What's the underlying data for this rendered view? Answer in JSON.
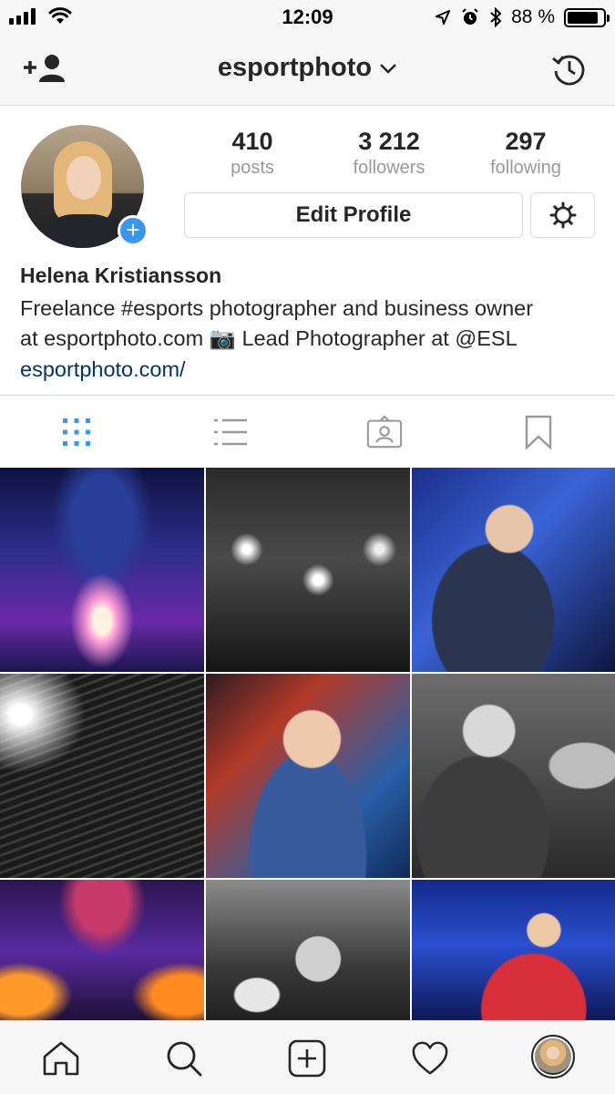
{
  "status_bar": {
    "time": "12:09",
    "battery_text": "88 %",
    "battery_level": 0.88
  },
  "nav": {
    "username": "esportphoto",
    "icons": [
      "add-user-icon",
      "chevron-down-icon",
      "history-icon"
    ]
  },
  "profile": {
    "name": "Helena Kristiansson",
    "bio_line1": "Freelance #esports photographer and business owner",
    "bio_line2": "at esportphoto.com 📷 Lead Photographer at @ESL",
    "website": "esportphoto.com/",
    "edit_label": "Edit Profile"
  },
  "stats": [
    {
      "value": "410",
      "label": "posts"
    },
    {
      "value": "3 212",
      "label": "followers"
    },
    {
      "value": "297",
      "label": "following"
    }
  ],
  "tabs": [
    "grid-icon",
    "list-icon",
    "tagged-icon",
    "bookmark-icon"
  ],
  "active_tab": "grid-icon",
  "grid_photos": [
    "arena-stage-photo",
    "players-stage-bw-photo",
    "gamer-shouting-photo",
    "crowd-lights-bw-photo",
    "caster-headset-photo",
    "player-trophy-bw-photo",
    "trophy-lift-photo",
    "player-clapping-bw-photo",
    "team-walkout-photo"
  ],
  "bottom_bar": [
    "home-icon",
    "search-icon",
    "add-post-icon",
    "activity-heart-icon",
    "profile-avatar"
  ],
  "colors": {
    "accent_blue": "#3897f0",
    "link": "#003569",
    "text": "#262626",
    "muted": "#999999",
    "border": "#dbdbdb"
  }
}
